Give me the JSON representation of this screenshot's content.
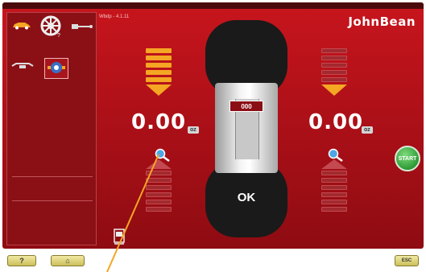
{
  "header": {
    "small_text": "Wbdp - 4.1.11",
    "brand": "JohnBean"
  },
  "sidebar": {
    "icons": [
      "car-icon",
      "wheel-icon",
      "weight-probe-icon",
      "tire-adapter-icon",
      "balance-mode-icon"
    ]
  },
  "left_plane": {
    "value": "0.00",
    "unit": "oz"
  },
  "right_plane": {
    "value": "0.00",
    "unit": "oz"
  },
  "wheel": {
    "display_value": "000",
    "status": "OK"
  },
  "buttons": {
    "start": "START",
    "help": "?",
    "home": "⌂",
    "esc": "ESC"
  },
  "colors": {
    "background": "#b9141c",
    "accent": "#f5a623",
    "start_green": "#2f9a35",
    "pointer_line": "#f5a623"
  }
}
